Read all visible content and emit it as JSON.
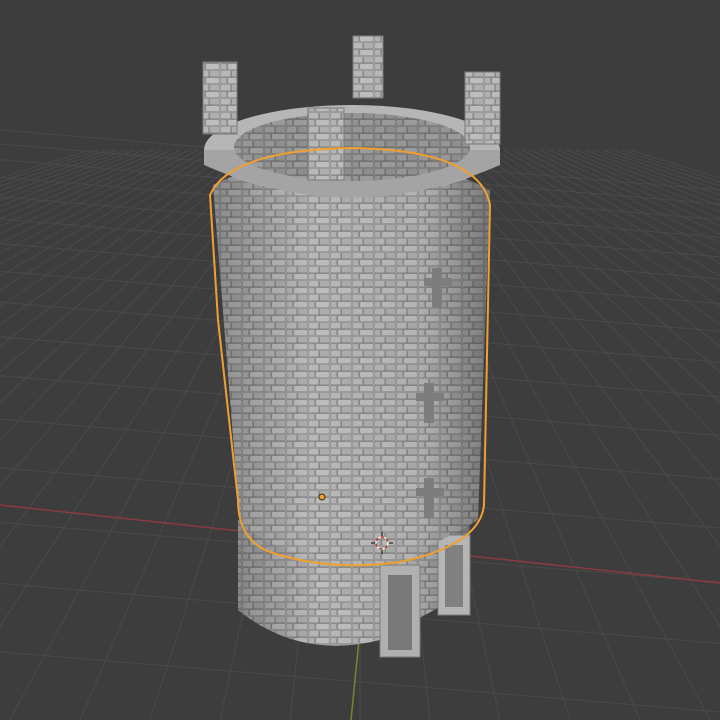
{
  "viewport": {
    "background": "#3d3d3d",
    "grid_color": "#4a4a4a",
    "x_axis_color": "#8a3a42",
    "y_axis_color": "#6e8a2e",
    "selection_outline_color": "#f0a030",
    "origin_color": "#f0a030"
  },
  "object": {
    "type": "stone-tower-mesh",
    "selected": true,
    "stone_color": "#a9a9a9",
    "stone_shadow_color": "#6f6f6f",
    "battlement_count": 4,
    "arrow_slit_count": 3,
    "has_door": true
  },
  "icons": {
    "cursor": "3d-cursor-icon",
    "origin": "object-origin-icon"
  }
}
